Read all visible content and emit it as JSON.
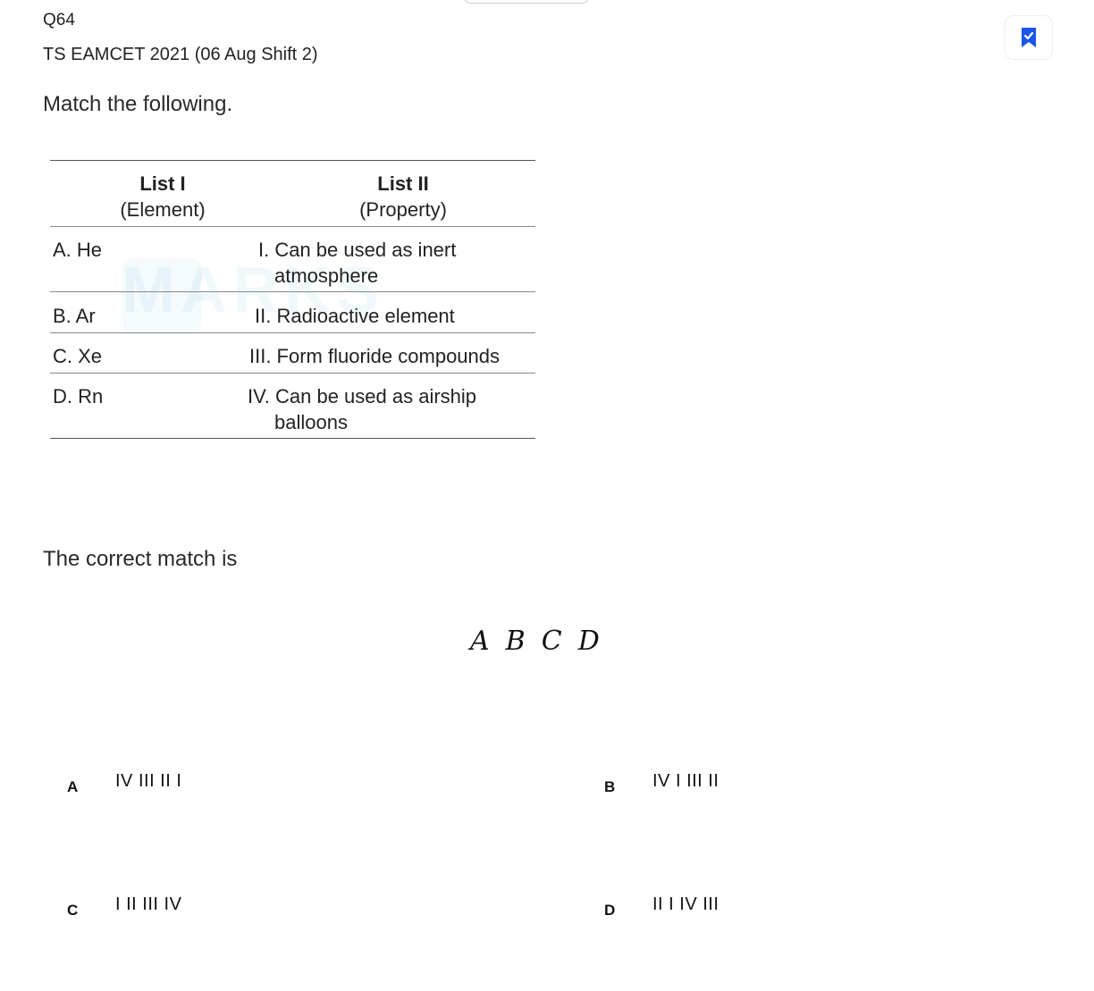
{
  "question": {
    "number": "Q64",
    "exam": "TS EAMCET 2021 (06 Aug Shift 2)",
    "prompt": "Match the following.",
    "lead": "The correct match is"
  },
  "table": {
    "col1_title": "List I",
    "col1_sub": "(Element)",
    "col2_title": "List II",
    "col2_sub": "(Property)",
    "rows": [
      {
        "left": "A.  He",
        "right_line1": "I. Can be used as inert",
        "right_line2": "atmosphere"
      },
      {
        "left": "B.  Ar",
        "right_line1": "II. Radioactive element",
        "right_line2": ""
      },
      {
        "left": "C.  Xe",
        "right_line1": "III. Form fluoride compounds",
        "right_line2": ""
      },
      {
        "left": "D.  Rn",
        "right_line1": "IV. Can be used as airship",
        "right_line2": "balloons"
      }
    ]
  },
  "header_letters": [
    "A",
    "B",
    "C",
    "D"
  ],
  "options": [
    {
      "letter": "A",
      "text": "IV III II I"
    },
    {
      "letter": "B",
      "text": "IV I III II"
    },
    {
      "letter": "C",
      "text": "I II III IV"
    },
    {
      "letter": "D",
      "text": "II I IV III"
    }
  ],
  "icons": {
    "bookmark": "bookmark-check-icon"
  },
  "colors": {
    "accent": "#1a56e8"
  }
}
